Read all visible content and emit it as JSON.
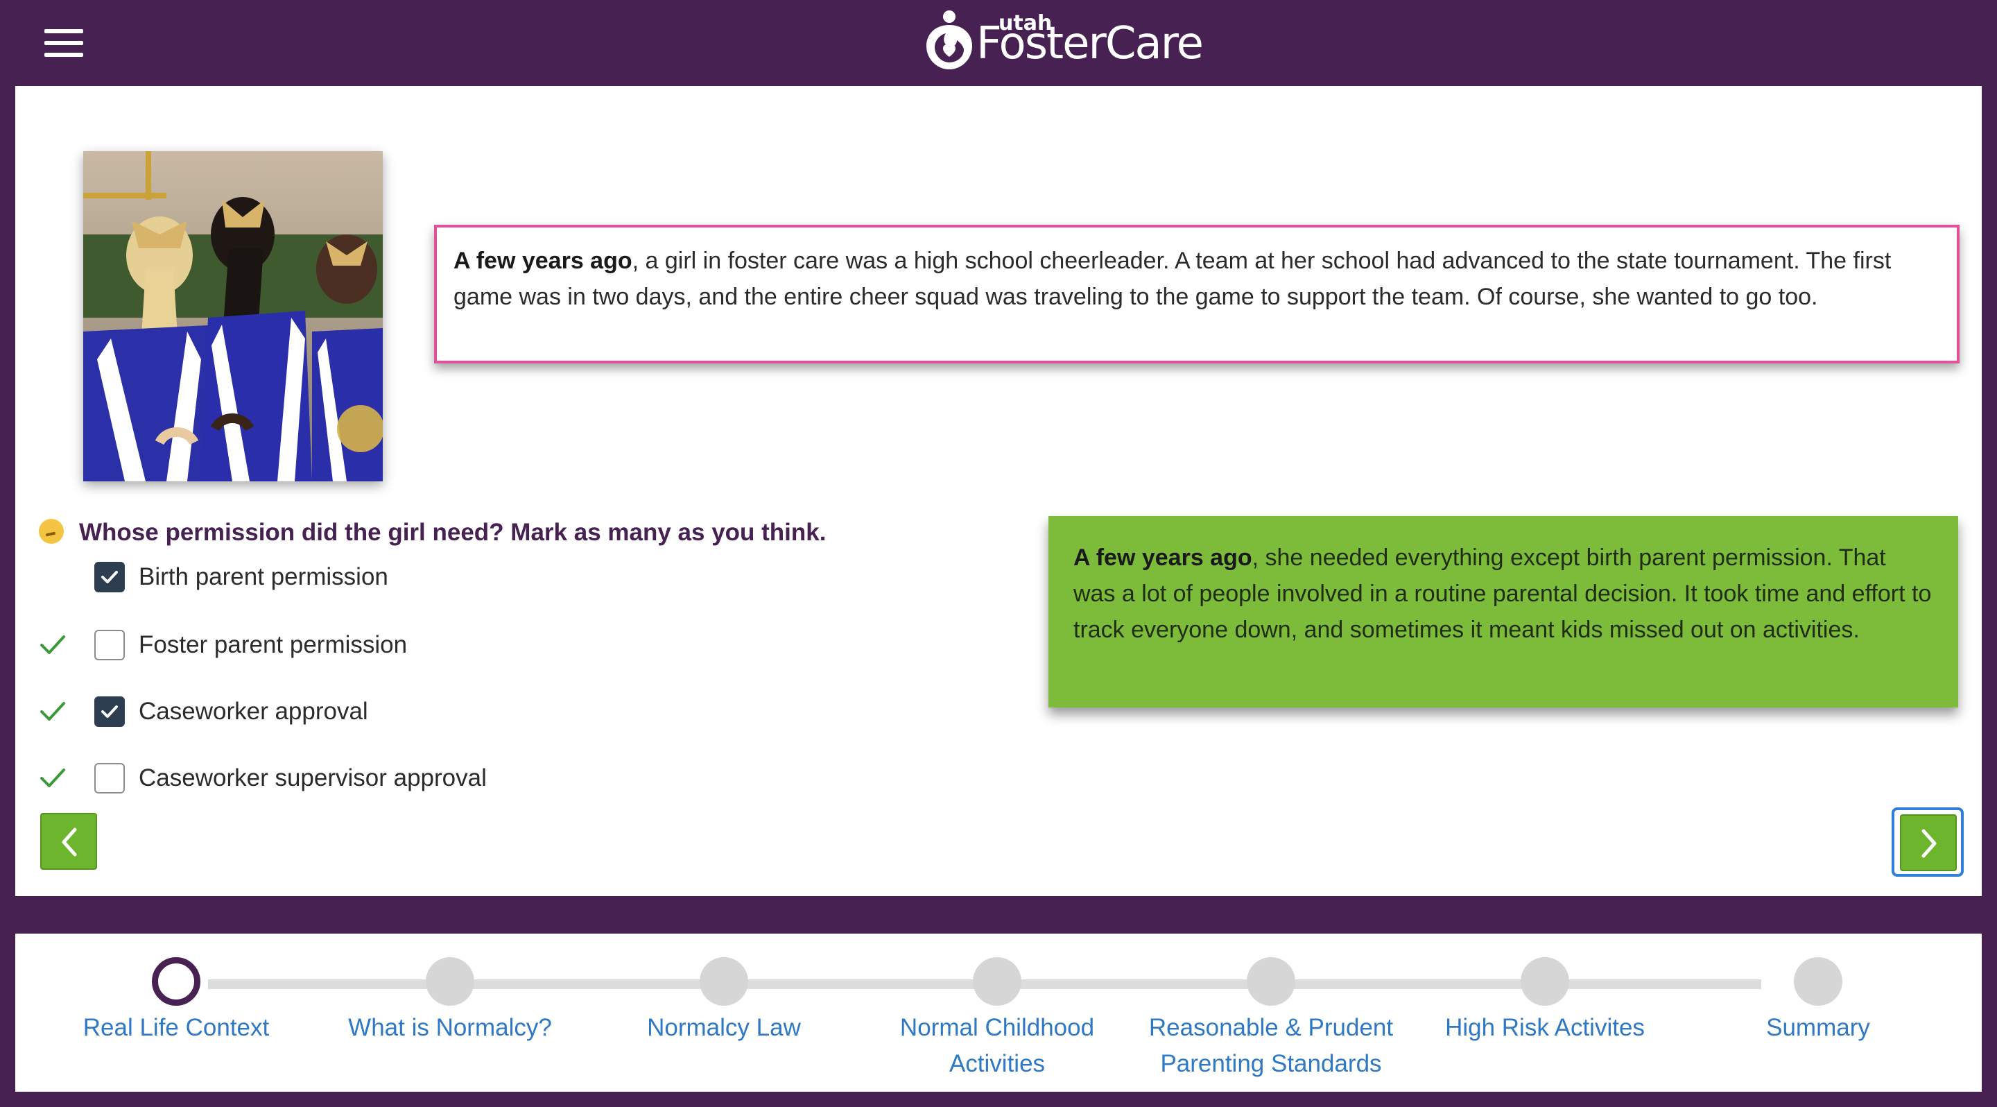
{
  "header": {
    "logo_small": "utah",
    "logo_big": "FosterCare",
    "brand_color": "#472152"
  },
  "story": {
    "lead": "A few years ago",
    "text": ", a girl in foster care was a high school cheerleader. A team at her school had advanced to the state tournament. The first game was in two days, and the entire cheer squad was traveling to the game to support the team. Of course, she wanted to go too."
  },
  "question": {
    "text": "Whose permission did the girl need? Mark as many as you think.",
    "options": [
      {
        "label": "Birth parent permission",
        "checked": true,
        "correct_mark": false
      },
      {
        "label": "Foster parent permission",
        "checked": false,
        "correct_mark": true
      },
      {
        "label": "Caseworker approval",
        "checked": true,
        "correct_mark": true
      },
      {
        "label": "Caseworker supervisor approval",
        "checked": false,
        "correct_mark": true
      }
    ]
  },
  "result": {
    "lead": "A few years ago",
    "text": ", she needed everything except birth parent permission. That was a lot of people involved in a routine parental decision. It took time and effort to track everyone down, and sometimes it meant kids missed out on activities."
  },
  "nav": {
    "prev_icon": "chevron-left-icon",
    "next_icon": "chevron-right-icon",
    "accent": "#6cb52d"
  },
  "steps": [
    {
      "label": "Real Life Context",
      "current": true
    },
    {
      "label": "What is Normalcy?",
      "current": false
    },
    {
      "label": "Normalcy Law",
      "current": false
    },
    {
      "label": "Normal Childhood Activities",
      "current": false
    },
    {
      "label": "Reasonable & Prudent Parenting Standards",
      "current": false
    },
    {
      "label": "High Risk Activites",
      "current": false
    },
    {
      "label": "Summary",
      "current": false
    }
  ]
}
